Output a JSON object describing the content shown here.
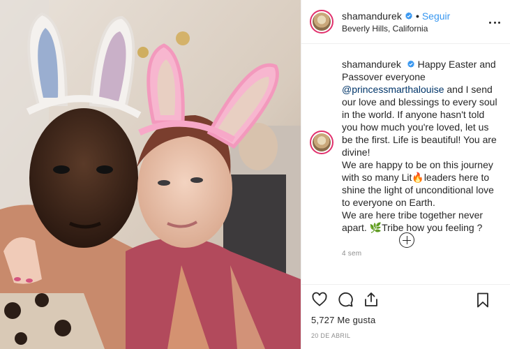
{
  "post": {
    "username": "shamandurek",
    "follow_label": "Seguir",
    "dot": "•",
    "location": "Beverly Hills, California",
    "caption": {
      "username": "shamandurek",
      "part1": "Happy Easter and Passover everyone",
      "mention": "@princessmarthalouise",
      "part2": "and I send our love and blessings to every soul in the world. If anyone hasn't told you how much you're loved, let us be the first. Life is beautiful! You are divine!",
      "part3a": "We are happy to be on this journey with so many Lit",
      "emoji_fire": "🔥",
      "part3b": "leaders here to shine the light of unconditional love to everyone on Earth.",
      "part4a": "We are here tribe together never apart.",
      "emoji_leaf": "🌿",
      "part4b": "Tribe how you feeling ?"
    },
    "time_ago": "4 sem",
    "likes": "5,727 Me gusta",
    "date": "20 DE ABRIL"
  },
  "icons": {
    "verified": "verified-badge-icon",
    "more": "more-options-icon",
    "like": "heart-icon",
    "comment": "comment-icon",
    "share": "share-icon",
    "save": "bookmark-icon",
    "load_more": "plus-circle-icon"
  },
  "colors": {
    "link": "#3897f0",
    "mention": "#003569",
    "secondary_text": "#8e8e8e",
    "ring": "#e1306c"
  }
}
